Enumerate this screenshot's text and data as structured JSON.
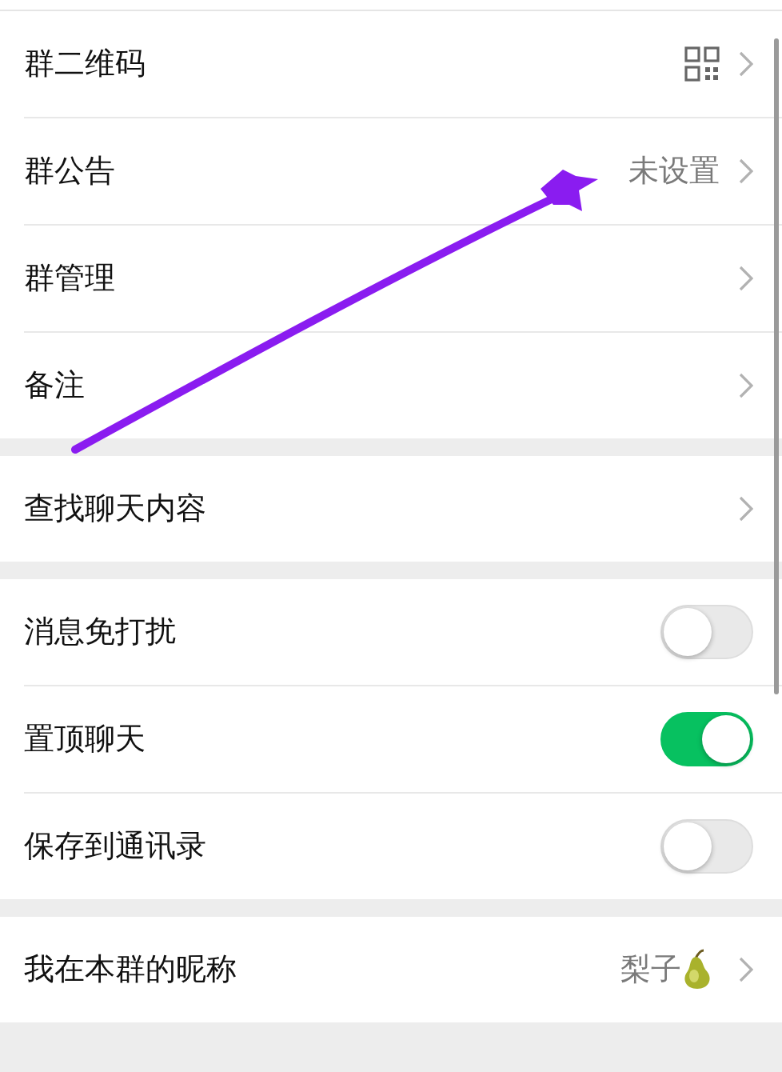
{
  "sections": [
    {
      "items": [
        {
          "kind": "qr",
          "label": "群二维码"
        },
        {
          "kind": "link",
          "label": "群公告",
          "value": "未设置"
        },
        {
          "kind": "link",
          "label": "群管理"
        },
        {
          "kind": "link",
          "label": "备注"
        }
      ]
    },
    {
      "items": [
        {
          "kind": "link",
          "label": "查找聊天内容"
        }
      ]
    },
    {
      "items": [
        {
          "kind": "toggle",
          "label": "消息免打扰",
          "on": false
        },
        {
          "kind": "toggle",
          "label": "置顶聊天",
          "on": true
        },
        {
          "kind": "toggle",
          "label": "保存到通讯录",
          "on": false
        }
      ]
    },
    {
      "items": [
        {
          "kind": "pear",
          "label": "我在本群的昵称",
          "value": "梨子"
        }
      ]
    }
  ]
}
